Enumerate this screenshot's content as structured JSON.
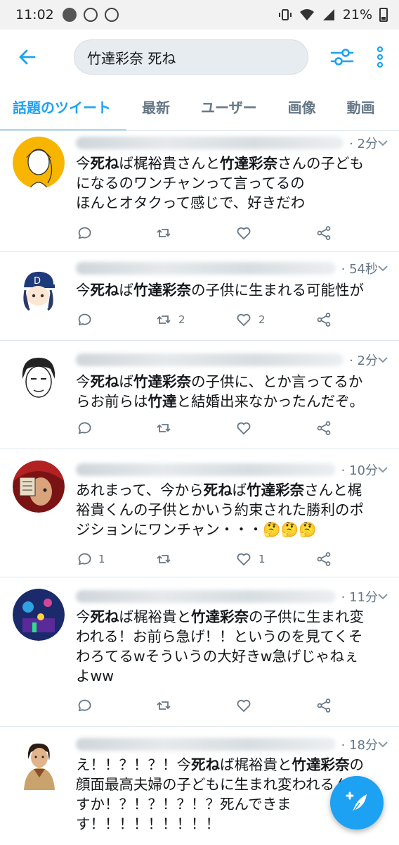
{
  "status_bar": {
    "time": "11:02",
    "battery": "21%"
  },
  "search": {
    "query": "竹達彩奈 死ね"
  },
  "tabs": [
    {
      "label": "話題のツイート",
      "active": true
    },
    {
      "label": "最新"
    },
    {
      "label": "ユーザー"
    },
    {
      "label": "画像"
    },
    {
      "label": "動画"
    }
  ],
  "colors": {
    "accent": "#1da1f2",
    "muted": "#657786"
  },
  "tweets": [
    {
      "time": "· 2分",
      "lines": [
        [
          {
            "t": "今"
          },
          {
            "t": "死ね",
            "b": true
          },
          {
            "t": "ば梶裕貴さんと"
          },
          {
            "t": "竹達彩奈",
            "b": true
          },
          {
            "t": "さんの子ども"
          }
        ],
        [
          {
            "t": "になるのワンチャンって言ってるの"
          }
        ],
        [
          {
            "t": "ほんとオタクって感じで、好きだわ"
          }
        ]
      ],
      "reply": "",
      "retweet": "",
      "like": ""
    },
    {
      "time": "· 54秒",
      "lines": [
        [
          {
            "t": "今"
          },
          {
            "t": "死ね",
            "b": true
          },
          {
            "t": "ば"
          },
          {
            "t": "竹達彩奈",
            "b": true
          },
          {
            "t": "の子供に生まれる可能性が"
          }
        ]
      ],
      "reply": "",
      "retweet": "2",
      "like": "2"
    },
    {
      "time": "· 2分",
      "lines": [
        [
          {
            "t": "今"
          },
          {
            "t": "死ね",
            "b": true
          },
          {
            "t": "ば"
          },
          {
            "t": "竹達彩奈",
            "b": true
          },
          {
            "t": "の子供に、とか言ってるか"
          }
        ],
        [
          {
            "t": "らお前らは"
          },
          {
            "t": "竹達",
            "b": true
          },
          {
            "t": "と結婚出来なかったんだぞ。"
          }
        ]
      ],
      "reply": "",
      "retweet": "",
      "like": ""
    },
    {
      "time": "· 10分",
      "lines": [
        [
          {
            "t": "あれまって、今から"
          },
          {
            "t": "死ね",
            "b": true
          },
          {
            "t": "ば"
          },
          {
            "t": "竹達彩奈",
            "b": true
          },
          {
            "t": "さんと梶"
          }
        ],
        [
          {
            "t": "裕貴くんの子供とかいう約束された勝利のポ"
          }
        ],
        [
          {
            "t": "ジションにワンチャン・・・🤔🤔🤔"
          }
        ]
      ],
      "reply": "1",
      "retweet": "",
      "like": "1"
    },
    {
      "time": "· 11分",
      "lines": [
        [
          {
            "t": "今"
          },
          {
            "t": "死ね",
            "b": true
          },
          {
            "t": "ば梶裕貴と"
          },
          {
            "t": "竹達彩奈",
            "b": true
          },
          {
            "t": "の子供に生まれ変"
          }
        ],
        [
          {
            "t": "われる！お前ら急げ！！というのを見てくそ"
          }
        ],
        [
          {
            "t": "わろてるwそういうの大好きw急げじゃねぇ"
          }
        ],
        [
          {
            "t": "よww"
          }
        ]
      ],
      "reply": "",
      "retweet": "",
      "like": ""
    },
    {
      "time": "· 18分",
      "lines": [
        [
          {
            "t": "え！！？！？！今"
          },
          {
            "t": "死ね",
            "b": true
          },
          {
            "t": "ば梶裕貴と"
          },
          {
            "t": "竹達彩奈",
            "b": true
          },
          {
            "t": "の"
          }
        ],
        [
          {
            "t": "顔面最高夫婦の子どもに生まれ変われるんで"
          }
        ],
        [
          {
            "t": "すか！？！？！？！？死んできま"
          }
        ],
        [
          {
            "t": "す！！！！！！！！！"
          }
        ]
      ],
      "reply": "",
      "retweet": "",
      "like": ""
    }
  ]
}
